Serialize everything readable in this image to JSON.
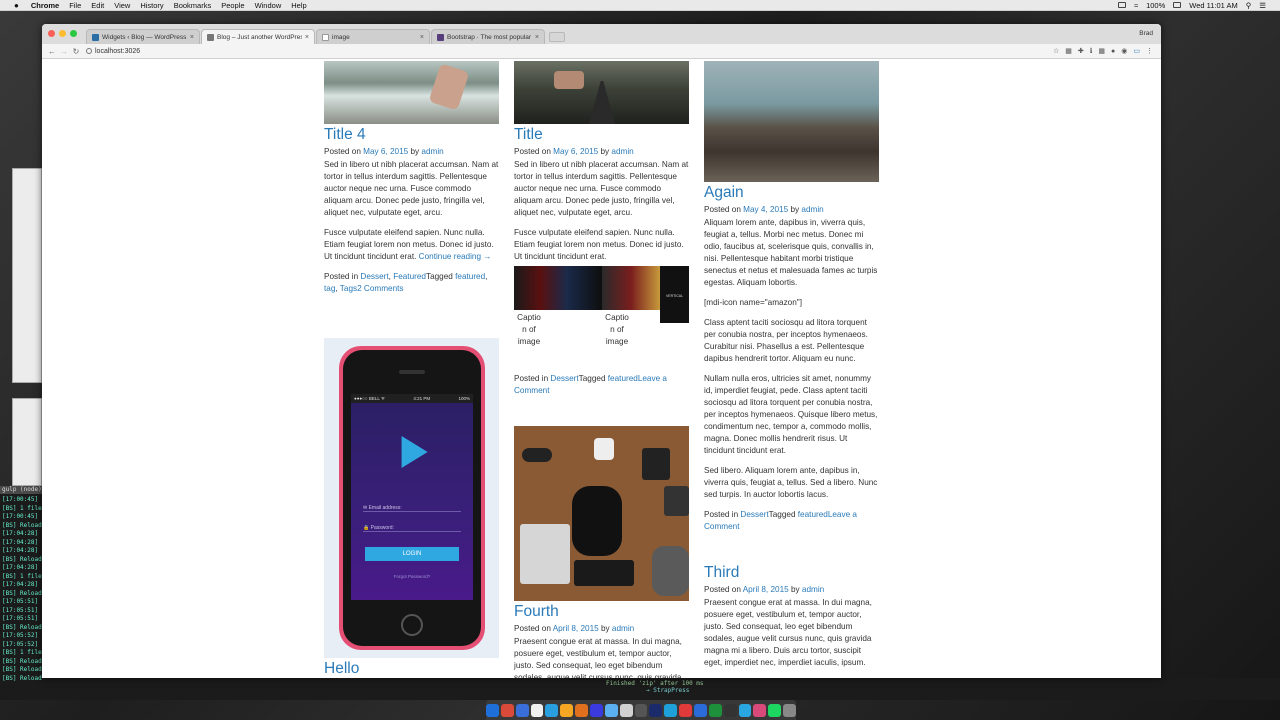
{
  "menubar": {
    "apple": "",
    "items": [
      "Chrome",
      "File",
      "Edit",
      "View",
      "History",
      "Bookmarks",
      "People",
      "Window",
      "Help"
    ],
    "clock": "Wed 11:01 AM",
    "battery": "100%"
  },
  "browser": {
    "tabs": [
      {
        "title": "Widgets ‹ Blog — WordPress",
        "active": false,
        "color": "#2b6ea6"
      },
      {
        "title": "Blog – Just another WordPress",
        "active": true,
        "color": "#777777"
      },
      {
        "title": "image",
        "active": false,
        "color": "#999999"
      },
      {
        "title": "Bootstrap · The most popular",
        "active": false,
        "color": "#563d7c"
      }
    ],
    "profile": "Brad",
    "url": "localhost:3026"
  },
  "posts": {
    "title4": {
      "title": "Title 4",
      "posted_on": "Posted on ",
      "date": "May 6, 2015",
      "by": " by ",
      "author": "admin",
      "para1": "Sed in libero ut nibh placerat accumsan. Nam at tortor in tellus interdum sagittis. Pellentesque auctor neque nec urna. Fusce commodo aliquam arcu. Donec pede justo, fringilla vel, aliquet nec, vulputate eget, arcu.",
      "para2": "Fusce vulputate eleifend sapien. Nunc nulla. Etiam feugiat lorem non metus. Donec id justo. Ut tincidunt tincidunt erat. ",
      "continue": "Continue reading →",
      "posted_in": "Posted in ",
      "cat1": "Dessert",
      "sep": ", ",
      "cat2": "Featured",
      "tagged": "Tagged ",
      "tag1": "featured",
      "tag2": "tag",
      "tag3": "Tags",
      "comments": "2 Comments"
    },
    "title": {
      "title": "Title",
      "posted_on": "Posted on ",
      "date": "May 6, 2015",
      "by": " by ",
      "author": "admin",
      "para1": "Sed in libero ut nibh placerat accumsan. Nam at tortor in tellus interdum sagittis. Pellentesque auctor neque nec urna. Fusce commodo aliquam arcu. Donec pede justo, fringilla vel, aliquet nec, vulputate eget, arcu.",
      "para2": "Fusce vulputate eleifend sapien. Nunc nulla. Etiam feugiat lorem non metus. Donec id justo. Ut tincidunt tincidunt erat.",
      "caption1": "Captio n of image",
      "caption2": "Captio n of image",
      "gallery_text": "VERTICAL",
      "posted_in": "Posted in ",
      "cat1": "Dessert",
      "tagged": "Tagged ",
      "tag1": "featured",
      "comment": "Leave a Comment"
    },
    "again": {
      "title": "Again",
      "posted_on": "Posted on ",
      "date": "May 4, 2015",
      "by": " by ",
      "author": "admin",
      "para1": "Aliquam lorem ante, dapibus in, viverra quis, feugiat a, tellus. Morbi nec metus. Donec mi odio, faucibus at, scelerisque quis, convallis in, nisi. Pellentesque habitant morbi tristique senectus et netus et malesuada fames ac turpis egestas. Aliquam lobortis.",
      "shortcode": "[mdi-icon name=\"amazon\"]",
      "para2": "Class aptent taciti sociosqu ad litora torquent per conubia nostra, per inceptos hymenaeos. Curabitur nisi. Phasellus a est. Pellentesque dapibus hendrerit tortor. Aliquam eu nunc.",
      "para3": "Nullam nulla eros, ultricies sit amet, nonummy id, imperdiet feugiat, pede. Class aptent taciti sociosqu ad litora torquent per conubia nostra, per inceptos hymenaeos. Quisque libero metus, condimentum nec, tempor a, commodo mollis, magna. Donec mollis hendrerit risus. Ut tincidunt tincidunt erat.",
      "para4": "Sed libero. Aliquam lorem ante, dapibus in, viverra quis, feugiat a, tellus. Sed a libero. Nunc sed turpis. In auctor lobortis lacus.",
      "posted_in": "Posted in ",
      "cat1": "Dessert",
      "tagged": "Tagged ",
      "tag1": "featured",
      "comment": "Leave a Comment"
    },
    "hello": {
      "title": "Hello",
      "phone_status_left": "●●●○○ BELL ᯤ",
      "phone_status_time": "4:21 PM",
      "phone_status_right": "100%",
      "email_label": "Email address:",
      "password_label": "Password:",
      "login": "LOGIN",
      "forgot": "Forgot Password?"
    },
    "fourth": {
      "title": "Fourth",
      "posted_on": "Posted on ",
      "date": "April 8, 2015",
      "by": " by ",
      "author": "admin",
      "para1": "Praesent congue erat at massa. In dui magna, posuere eget, vestibulum et, tempor auctor, justo. Sed consequat, leo eget bibendum sodales, augue velit cursus nunc, quis gravida"
    },
    "third": {
      "title": "Third",
      "posted_on": "Posted on ",
      "date": "April 8, 2015",
      "by": " by ",
      "author": "admin",
      "para1": "Praesent congue erat at massa. In dui magna, posuere eget, vestibulum et, tempor auctor, justo. Sed consequat, leo eget bibendum sodales, augue velit cursus nunc, quis gravida magna mi a libero. Duis arcu tortor, suscipit eget, imperdiet nec, imperdiet iaculis, ipsum."
    }
  },
  "terminal": {
    "header": "gulp (node)",
    "lines": [
      "[17:00:45]",
      "[BS] 1 file",
      "[17:00:45]",
      "[BS] Reload",
      "[17:04:28]",
      "[17:04:28]",
      "[17:04:28]",
      "[BS] Reload",
      "[17:04:28]",
      "[BS] 1 file",
      "[17:04:28]",
      "[BS] Reload",
      "[17:05:51]",
      "[17:05:51]",
      "[17:05:51]",
      "[BS] Reload",
      "[17:05:52]",
      "[17:05:52]",
      "[BS] 1 file",
      "[BS] Reload",
      "[BS] Reload",
      "[BS] Reloading Browsers..."
    ],
    "bottom": "Finished 'zip' after 100 ms",
    "prompt": "→ StrapPress"
  },
  "dock_colors": [
    "#1e6fd9",
    "#d94a3a",
    "#3a6fd9",
    "#f0f0f0",
    "#2a9fe0",
    "#f5a623",
    "#e0701e",
    "#3a3adf",
    "#5ab0f0",
    "#d0d0d0",
    "#555555",
    "#1a2a6a",
    "#1ea0d9",
    "#e03a3a",
    "#2a6ad9",
    "#1e8f3a",
    "#333333",
    "#2aa6e0",
    "#d94a7a",
    "#1ed760",
    "#888888"
  ]
}
